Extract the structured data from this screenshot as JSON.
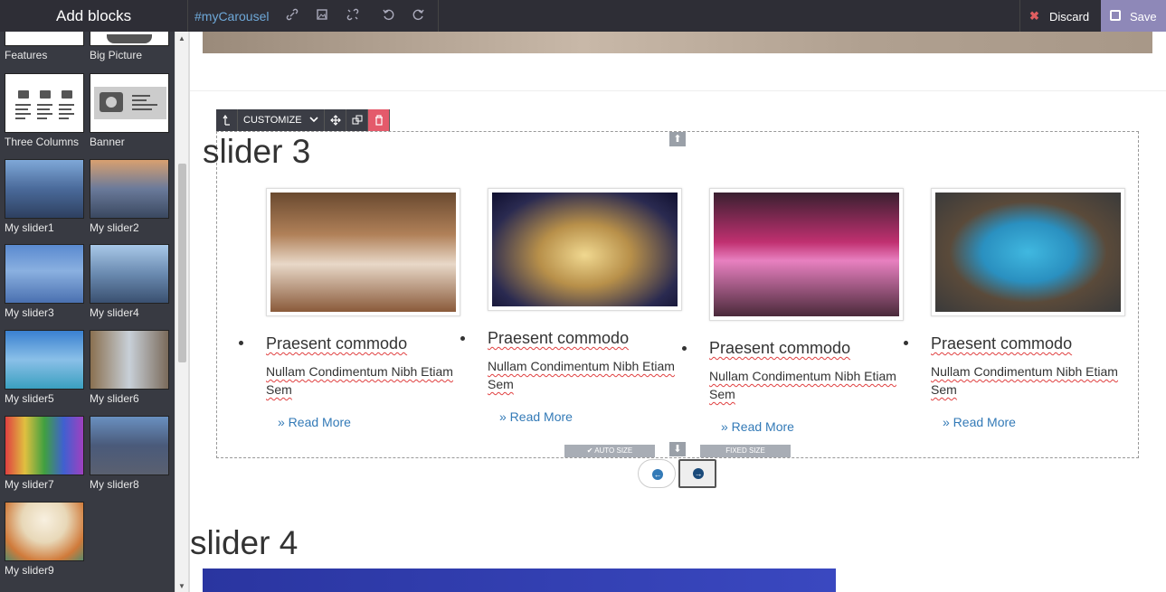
{
  "topbar": {
    "title": "Add blocks",
    "selector": "#myCarousel",
    "discard_label": "Discard",
    "save_label": "Save"
  },
  "sidebar": {
    "blocks": [
      {
        "label": "Features"
      },
      {
        "label": "Big Picture"
      },
      {
        "label": "Three Columns"
      },
      {
        "label": "Banner"
      },
      {
        "label": "My slider1"
      },
      {
        "label": "My slider2"
      },
      {
        "label": "My slider3"
      },
      {
        "label": "My slider4"
      },
      {
        "label": "My slider5"
      },
      {
        "label": "My slider6"
      },
      {
        "label": "My slider7"
      },
      {
        "label": "My slider8"
      },
      {
        "label": "My slider9"
      }
    ]
  },
  "editor": {
    "toolbar": {
      "customize_label": "CUSTOMIZE"
    },
    "slider3": {
      "heading": "slider 3",
      "cards": [
        {
          "title": "Praesent commodo",
          "desc": "Nullam Condimentum Nibh Etiam Sem",
          "more": "» Read More"
        },
        {
          "title": "Praesent commodo",
          "desc": "Nullam Condimentum Nibh Etiam Sem",
          "more": "» Read More"
        },
        {
          "title": "Praesent commodo",
          "desc": "Nullam Condimentum Nibh Etiam Sem",
          "more": "» Read More"
        },
        {
          "title": "Praesent commodo",
          "desc": "Nullam Condimentum Nibh Etiam Sem",
          "more": "» Read More"
        }
      ],
      "auto_size_label": "AUTO SIZE",
      "fixed_size_label": "FIXED SIZE"
    },
    "slider4": {
      "heading": "slider 4"
    }
  },
  "colors": {
    "topbar": "#2e2e36",
    "sidebar": "#383a42",
    "save": "#8e88b8",
    "link": "#337ab7",
    "delete": "#e45a6b"
  }
}
